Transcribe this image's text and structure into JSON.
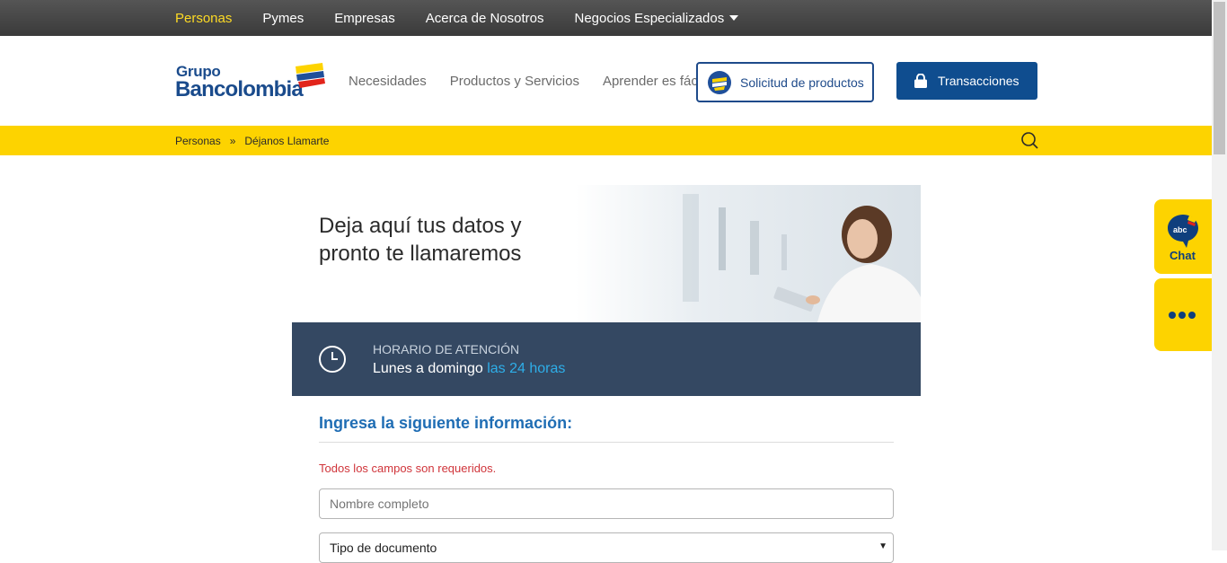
{
  "topnav": {
    "items": [
      {
        "label": "Personas",
        "active": true
      },
      {
        "label": "Pymes"
      },
      {
        "label": "Empresas"
      },
      {
        "label": "Acerca de Nosotros"
      },
      {
        "label": "Negocios Especializados",
        "has_dropdown": true
      }
    ]
  },
  "brand": {
    "line1": "Grupo",
    "line2": "Bancolombia"
  },
  "mainnav": {
    "items": [
      "Necesidades",
      "Productos y Servicios",
      "Aprender es fácil"
    ]
  },
  "buttons": {
    "solicitud": "Solicitud de productos",
    "transacciones": "Transacciones"
  },
  "breadcrumb": {
    "items": [
      "Personas",
      "Déjanos Llamarte"
    ],
    "separator": "»"
  },
  "hero": {
    "title": "Deja aquí tus datos y pronto te llamaremos"
  },
  "hours": {
    "label": "HORARIO DE ATENCIÓN",
    "days": "Lunes a domingo",
    "time": "las 24 horas"
  },
  "form": {
    "title": "Ingresa la siguiente información:",
    "required_note": "Todos los campos son requeridos.",
    "name_placeholder": "Nombre completo",
    "doc_type_label": "Tipo de documento"
  },
  "side": {
    "chat_label": "Chat",
    "chat_badge": "abc"
  },
  "colors": {
    "brand_blue": "#0f4d8f",
    "yellow": "#fdd300",
    "hours_bg": "#344862",
    "accent_blue": "#2eaee8",
    "error_red": "#d0343a"
  }
}
